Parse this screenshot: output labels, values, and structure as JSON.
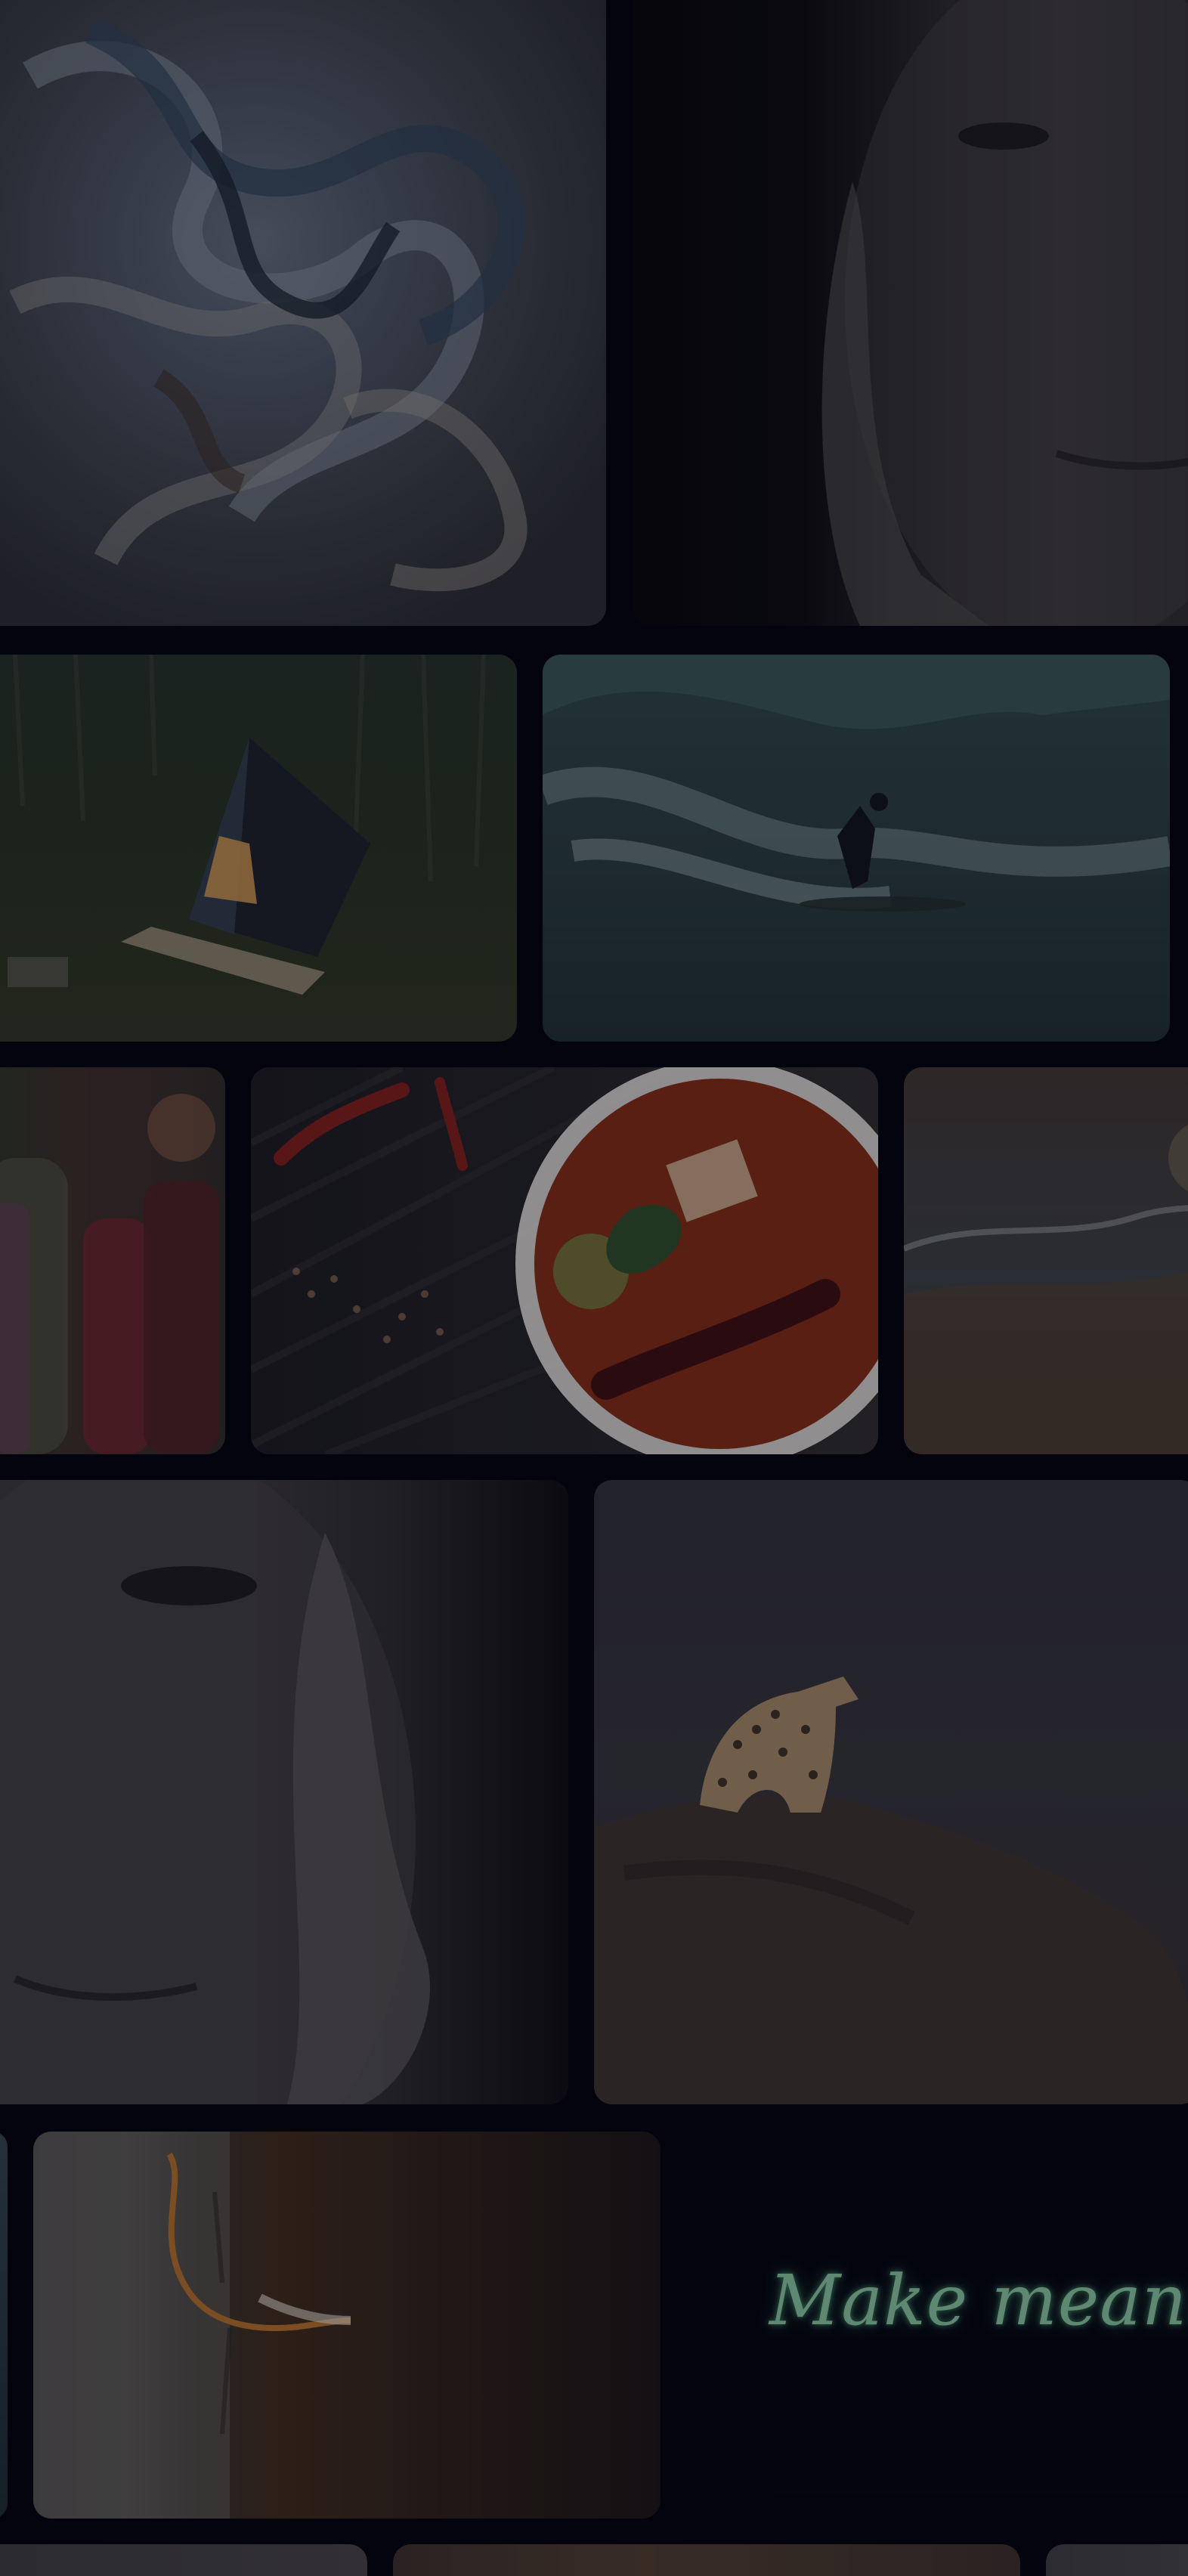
{
  "gallery": {
    "neon_sign_text": "Make meaning",
    "tiles": [
      {
        "subject": "abstract-swirl"
      },
      {
        "subject": "portrait-face-hand"
      },
      {
        "subject": "a-frame-cabin-forest"
      },
      {
        "subject": "surfer-wave"
      },
      {
        "subject": "people-group"
      },
      {
        "subject": "curry-bowl-chilies"
      },
      {
        "subject": "beach-sunset"
      },
      {
        "subject": "portrait-face-hand-closeup"
      },
      {
        "subject": "leopard-on-rock"
      },
      {
        "subject": "birch-bark-rope"
      },
      {
        "subject": "neon-sign"
      }
    ]
  },
  "colors": {
    "background": "#05050f",
    "neon": "#9fe3b6"
  }
}
